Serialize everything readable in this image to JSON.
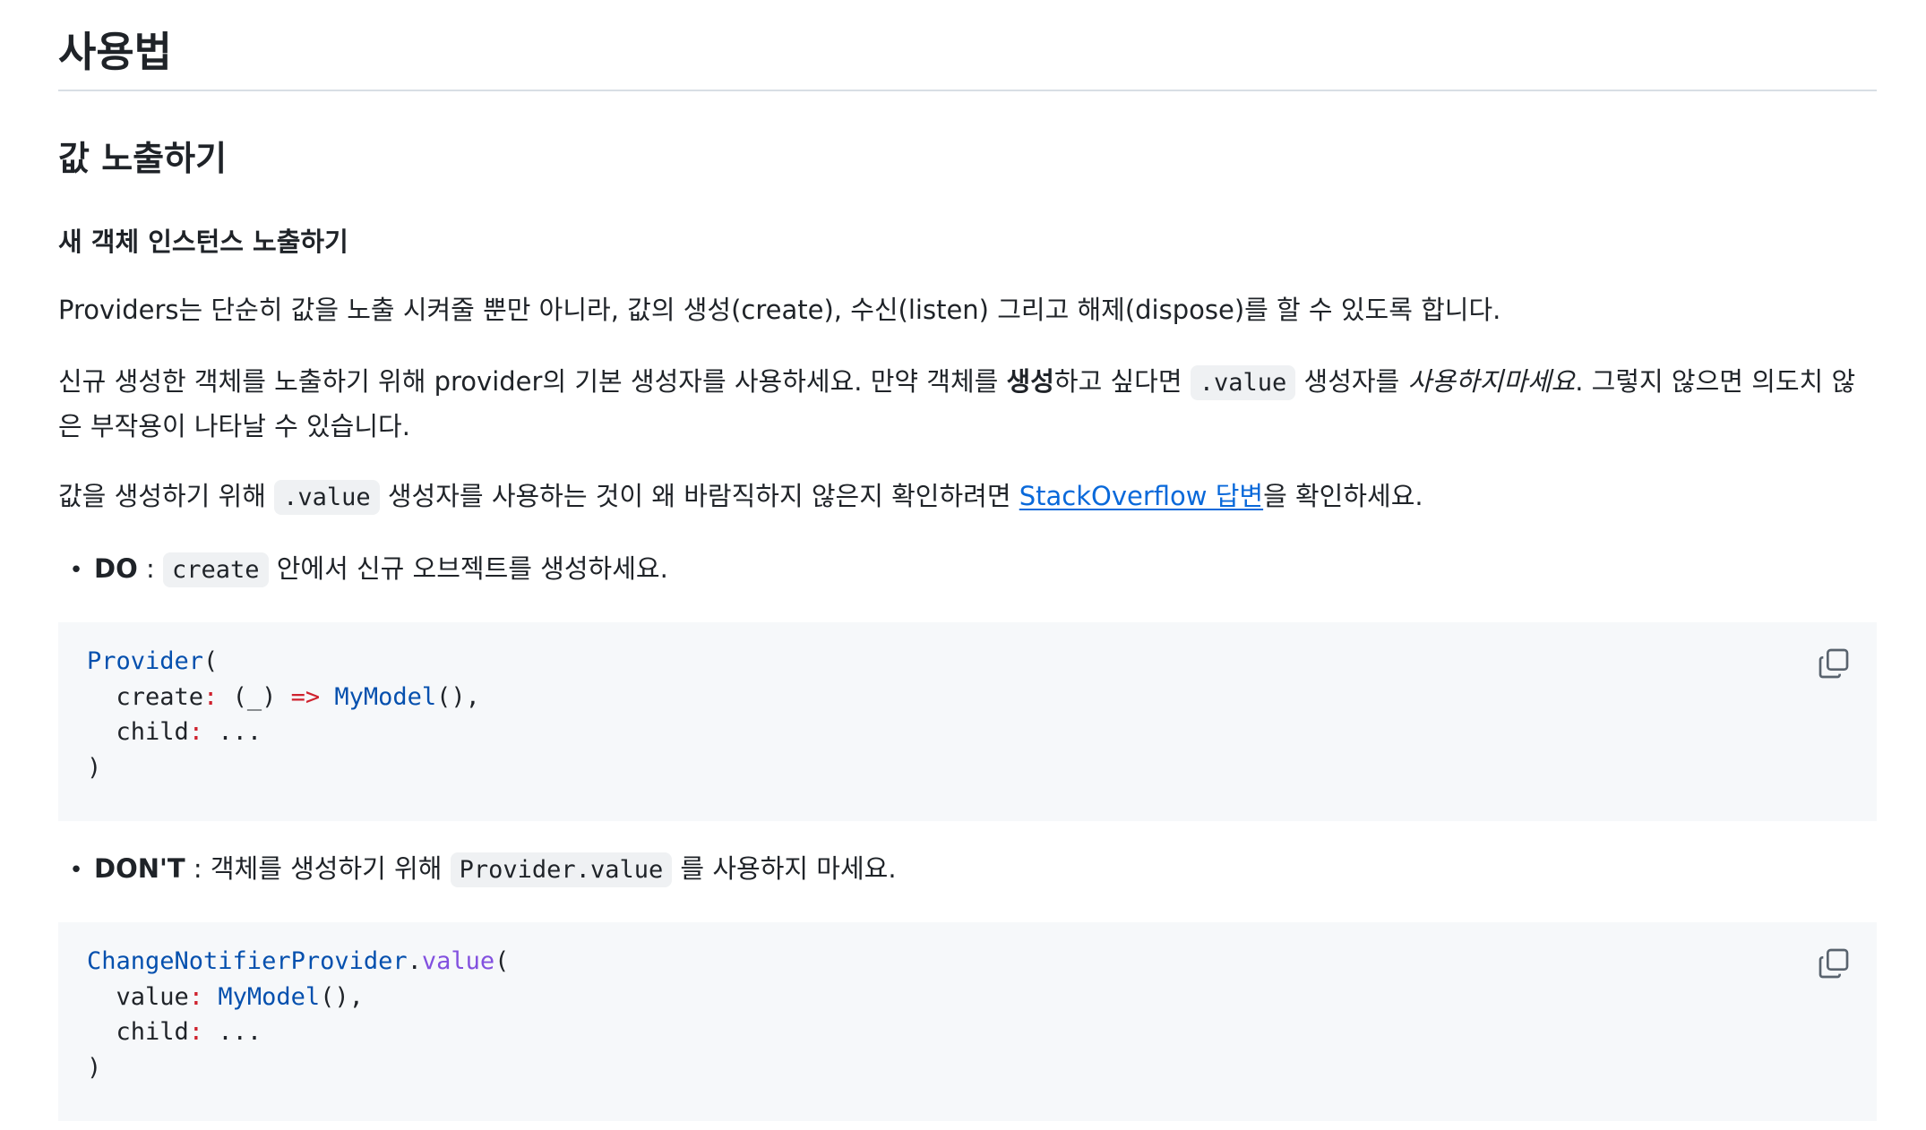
{
  "h1": "사용법",
  "h2": "값 노출하기",
  "h3": "새 객체 인스턴스 노출하기",
  "p1": "Providers는 단순히 값을 노출 시켜줄 뿐만 아니라, 값의 생성(create), 수신(listen) 그리고 해제(dispose)를 할 수 있도록 합니다.",
  "p2": {
    "t1": "신규 생성한 객체를 노출하기 위해 provider의 기본 생성자를 사용하세요. 만약 객체를 ",
    "bold": "생성",
    "t2": "하고 싶다면 ",
    "code": ".value",
    "t3": " 생성자를 ",
    "em": "사용하지마세요",
    "t4": ". 그렇지 않으면 의도치 않은 부작용이 나타날 수 있습니다."
  },
  "p3": {
    "t1": "값을 생성하기 위해 ",
    "code": ".value",
    "t2": " 생성자를 사용하는 것이 왜 바람직하지 않은지 확인하려면 ",
    "link": "StackOverflow 답변",
    "t3": "을 확인하세요."
  },
  "bullet1": {
    "strong": "DO",
    "sep": " : ",
    "code": "create",
    "text": " 안에서 신규 오브젝트를 생성하세요."
  },
  "code1": {
    "l1_type": "Provider",
    "l1_rest": "(",
    "l2_key": "  create",
    "l2_colon": ":",
    "l2_mid": " (_) ",
    "l2_arrow": "=>",
    "l2_sp": " ",
    "l2_type": "MyModel",
    "l2_rest": "(),",
    "l3_key": "  child",
    "l3_colon": ":",
    "l3_rest": " ...",
    "l4": ")"
  },
  "bullet2": {
    "strong": "DON'T",
    "sep": " : 객체를 생성하기 위해 ",
    "code": "Provider.value",
    "text": " 를 사용하지 마세요."
  },
  "code2": {
    "l1_type": "ChangeNotifierProvider",
    "l1_dot": ".",
    "l1_meth": "value",
    "l1_rest": "(",
    "l2_key": "  value",
    "l2_colon": ":",
    "l2_sp": " ",
    "l2_type": "MyModel",
    "l2_rest": "(),",
    "l3_key": "  child",
    "l3_colon": ":",
    "l3_rest": " ...",
    "l4": ")"
  },
  "icons": {
    "copy": "copy-icon"
  },
  "colors": {
    "link": "#0969da",
    "code_bg": "#f6f8fa",
    "keyword_type": "#0550ae",
    "operator": "#cf222e"
  }
}
